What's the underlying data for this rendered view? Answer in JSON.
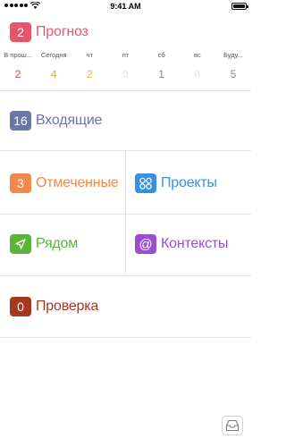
{
  "statusbar": {
    "time": "9:41 AM",
    "signal_icon": "signal-dots-icon",
    "wifi_icon": "wifi-icon",
    "battery_icon": "battery-icon"
  },
  "forecast": {
    "count": "2",
    "label": "Прогноз",
    "color": "#e8536d",
    "days": [
      {
        "name": "В прош...",
        "count": "2",
        "color": "#e8404f"
      },
      {
        "name": "Сегодня",
        "count": "4",
        "color": "#f0a429"
      },
      {
        "name": "чт",
        "count": "2",
        "color": "#f0b43a"
      },
      {
        "name": "пт",
        "count": "0",
        "color": "#e3e3e3"
      },
      {
        "name": "сб",
        "count": "1",
        "color": "#8a8a8a"
      },
      {
        "name": "вс",
        "count": "0",
        "color": "#e3e3e3"
      },
      {
        "name": "Буду...",
        "count": "5",
        "color": "#8a8a8a"
      }
    ]
  },
  "inbox": {
    "count": "16",
    "label": "Входящие",
    "color": "#6a76a6"
  },
  "flagged": {
    "count": "3",
    "label": "Отмеченные",
    "color": "#f2894a"
  },
  "projects": {
    "label": "Проекты",
    "color": "#3a8fe0",
    "icon": "projects-icon"
  },
  "nearby": {
    "label": "Рядом",
    "color": "#5ab53a",
    "icon": "location-arrow-icon"
  },
  "contexts": {
    "label": "Контексты",
    "color": "#9a4fd0",
    "icon": "at-icon"
  },
  "review": {
    "count": "0",
    "label": "Проверка",
    "color": "#a33a1f"
  },
  "toolbar": {
    "inbox_button_icon": "inbox-tray-icon"
  }
}
